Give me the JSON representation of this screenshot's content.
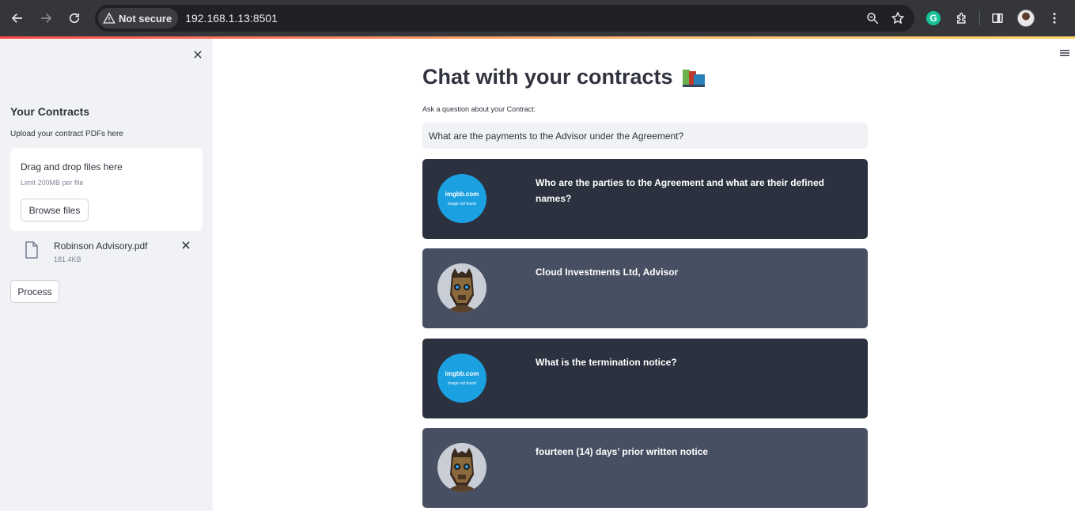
{
  "browser": {
    "security_label": "Not secure",
    "url": "192.168.1.13:8501"
  },
  "sidebar": {
    "title": "Your Contracts",
    "subtitle": "Upload your contract PDFs here",
    "uploader": {
      "drop_text": "Drag and drop files here",
      "limit_text": "Limit 200MB per file",
      "browse_label": "Browse files"
    },
    "file": {
      "name": "Robinson Advisory.pdf",
      "size": "181.4KB"
    },
    "process_label": "Process"
  },
  "main": {
    "title": "Chat with your contracts",
    "question_label": "Ask a question about your Contract:",
    "question_value": "What are the payments to the Advisor under the Agreement?"
  },
  "avatars": {
    "user_line1": "imgbb.com",
    "user_line2": "image not found"
  },
  "messages": [
    {
      "role": "user",
      "text": "Who are the parties to the Agreement and what are their defined names?"
    },
    {
      "role": "bot",
      "text": "Cloud Investments Ltd, Advisor"
    },
    {
      "role": "user",
      "text": "What is the termination notice?"
    },
    {
      "role": "bot",
      "text": "fourteen (14) days’ prior written notice"
    }
  ]
}
